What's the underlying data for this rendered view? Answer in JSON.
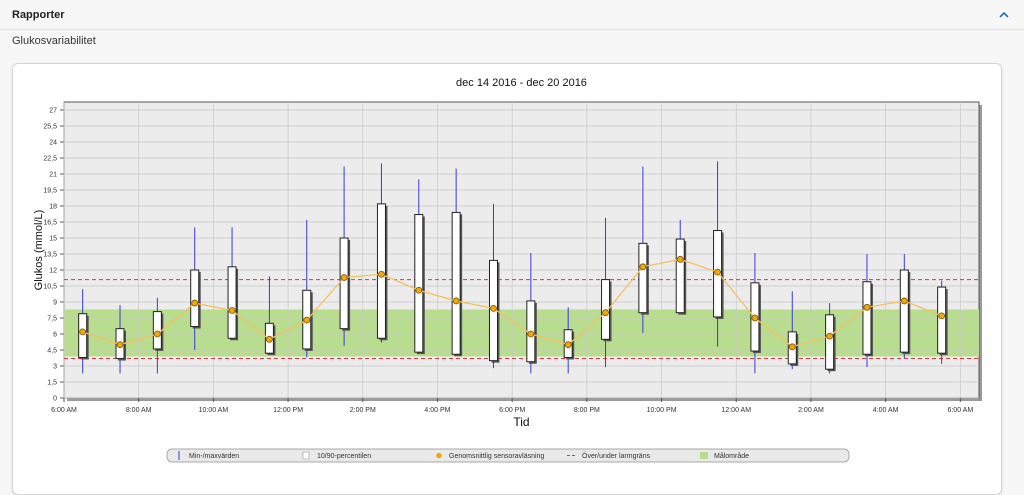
{
  "header": {
    "title": "Rapporter"
  },
  "subtitle": "Glukosvariabilitet",
  "colors": {
    "target": "#b9dd8f",
    "limit": "#e0343c",
    "median": "#f0a810",
    "minmax": "#3a3ad8",
    "plot_bg": "#ececec"
  },
  "chart_data": {
    "type": "box",
    "title": "dec 14 2016 - dec 20 2016",
    "xlabel": "Tid",
    "ylabel": "Glukos (mmol/L)",
    "ylim": [
      0,
      27.75
    ],
    "xlim": [
      6,
      30.5
    ],
    "y_ticks": [
      "0",
      "1,5",
      "3",
      "4,5",
      "6",
      "7,5",
      "9",
      "10,5",
      "12",
      "13,5",
      "15",
      "16,5",
      "18",
      "19,5",
      "21",
      "22,5",
      "24",
      "25,5",
      "27"
    ],
    "x_ticks": [
      "6:00 AM",
      "8:00 AM",
      "10:00 AM",
      "12:00 PM",
      "2:00 PM",
      "4:00 PM",
      "6:00 PM",
      "8:00 PM",
      "10:00 PM",
      "12:00 AM",
      "2:00 AM",
      "4:00 AM",
      "6:00 AM"
    ],
    "grid": true,
    "target_range": [
      3.9,
      8.3
    ],
    "alarm_limits": [
      3.7,
      11.1
    ],
    "series": [
      {
        "name": "Min-/maxvärden",
        "kind": "whisker"
      },
      {
        "name": "10/90-percentilen",
        "kind": "box"
      },
      {
        "name": "Genomsnittlig sensoravläsning",
        "kind": "line"
      },
      {
        "name": "Över/under larmgräns",
        "kind": "dashed"
      },
      {
        "name": "Målområde",
        "kind": "band"
      }
    ],
    "points": [
      {
        "x": 6.5,
        "min": 2.3,
        "max": 10.2,
        "p10": 3.8,
        "p90": 7.9,
        "mean": 6.2
      },
      {
        "x": 7.5,
        "min": 2.3,
        "max": 8.7,
        "p10": 3.7,
        "p90": 6.5,
        "mean": 5.0
      },
      {
        "x": 8.5,
        "min": 2.3,
        "max": 9.4,
        "p10": 4.6,
        "p90": 8.1,
        "mean": 6.0
      },
      {
        "x": 9.5,
        "min": 4.5,
        "max": 16.0,
        "p10": 6.7,
        "p90": 12.0,
        "mean": 8.9
      },
      {
        "x": 10.5,
        "min": 5.6,
        "max": 16.0,
        "p10": 5.6,
        "p90": 12.3,
        "mean": 8.2
      },
      {
        "x": 11.5,
        "min": 4.2,
        "max": 11.4,
        "p10": 4.2,
        "p90": 7.0,
        "mean": 5.5
      },
      {
        "x": 12.5,
        "min": 3.8,
        "max": 16.7,
        "p10": 4.6,
        "p90": 10.1,
        "mean": 7.3
      },
      {
        "x": 13.5,
        "min": 4.9,
        "max": 21.7,
        "p10": 6.5,
        "p90": 15.0,
        "mean": 11.3
      },
      {
        "x": 14.5,
        "min": 5.2,
        "max": 22.0,
        "p10": 5.6,
        "p90": 18.2,
        "mean": 11.6
      },
      {
        "x": 15.5,
        "min": 4.3,
        "max": 20.5,
        "p10": 4.3,
        "p90": 17.2,
        "mean": 10.1
      },
      {
        "x": 16.5,
        "min": 4.1,
        "max": 21.5,
        "p10": 4.1,
        "p90": 17.4,
        "mean": 9.1
      },
      {
        "x": 17.5,
        "min": 2.8,
        "max": 18.2,
        "p10": 3.5,
        "p90": 12.9,
        "mean": 8.4
      },
      {
        "x": 18.5,
        "min": 2.3,
        "max": 13.6,
        "p10": 3.4,
        "p90": 9.1,
        "mean": 6.0
      },
      {
        "x": 19.5,
        "min": 2.3,
        "max": 8.5,
        "p10": 3.8,
        "p90": 6.4,
        "mean": 5.0
      },
      {
        "x": 20.5,
        "min": 2.9,
        "max": 16.9,
        "p10": 5.5,
        "p90": 11.1,
        "mean": 8.0
      },
      {
        "x": 21.5,
        "min": 6.1,
        "max": 21.7,
        "p10": 8.0,
        "p90": 14.5,
        "mean": 12.3
      },
      {
        "x": 22.5,
        "min": 8.0,
        "max": 16.7,
        "p10": 8.0,
        "p90": 14.9,
        "mean": 13.0
      },
      {
        "x": 23.5,
        "min": 4.8,
        "max": 22.2,
        "p10": 7.6,
        "p90": 15.7,
        "mean": 11.8
      },
      {
        "x": 24.5,
        "min": 2.3,
        "max": 13.6,
        "p10": 4.4,
        "p90": 10.8,
        "mean": 7.5
      },
      {
        "x": 25.5,
        "min": 2.7,
        "max": 10.0,
        "p10": 3.2,
        "p90": 6.2,
        "mean": 4.8
      },
      {
        "x": 26.5,
        "min": 2.3,
        "max": 8.9,
        "p10": 2.7,
        "p90": 7.8,
        "mean": 5.8
      },
      {
        "x": 27.5,
        "min": 2.9,
        "max": 13.5,
        "p10": 4.1,
        "p90": 10.9,
        "mean": 8.5
      },
      {
        "x": 28.5,
        "min": 3.7,
        "max": 13.5,
        "p10": 4.3,
        "p90": 12.0,
        "mean": 9.1
      },
      {
        "x": 29.5,
        "min": 3.2,
        "max": 11.0,
        "p10": 4.2,
        "p90": 10.4,
        "mean": 7.7
      }
    ]
  }
}
